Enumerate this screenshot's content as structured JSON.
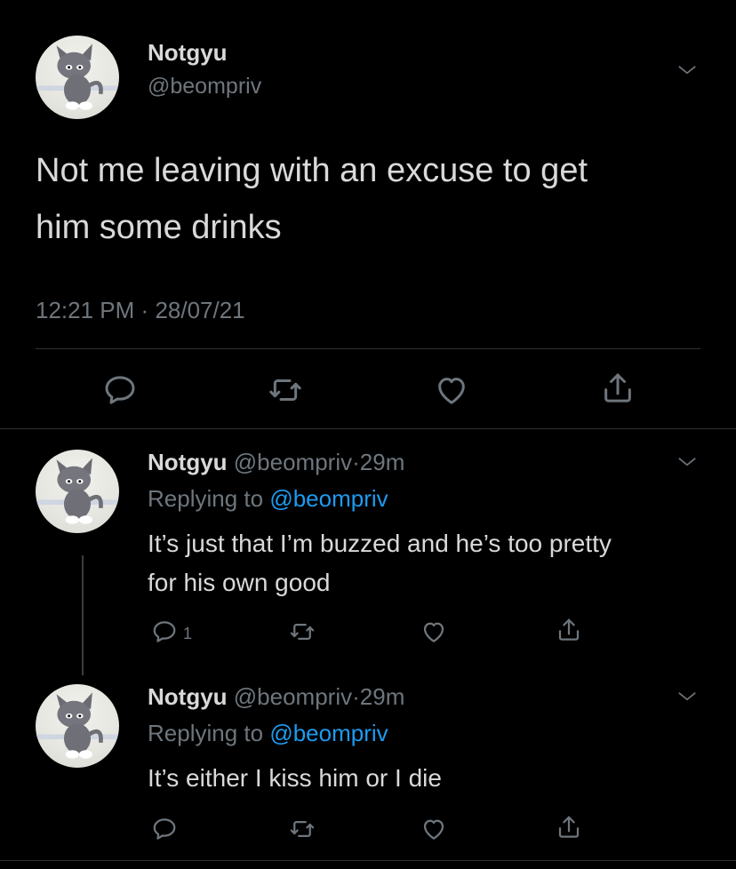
{
  "main_tweet": {
    "display_name": "Notgyu",
    "handle": "@beompriv",
    "text_line1": "Not me leaving with an excuse to get",
    "text_line2": "him some drinks",
    "time": "12:21 PM",
    "separator": "·",
    "date": "28/07/21"
  },
  "replies": [
    {
      "display_name": "Notgyu",
      "handle": "@beompriv",
      "separator": "·",
      "age": "29m",
      "replying_prefix": "Replying to",
      "replying_to": "@beompriv",
      "text_line1": "It’s just that I’m buzzed and he’s too pretty",
      "text_line2": "for his own good",
      "reply_count": "1"
    },
    {
      "display_name": "Notgyu",
      "handle": "@beompriv",
      "separator": "·",
      "age": "29m",
      "replying_prefix": "Replying to",
      "replying_to": "@beompriv",
      "text_line1": "It’s either I kiss him or I die"
    }
  ],
  "colors": {
    "background": "#000000",
    "text": "#d9d9d9",
    "muted": "#6e767d",
    "link": "#1d9bf0",
    "divider": "#2f3336"
  },
  "icons": [
    "chevron-down-icon",
    "reply-icon",
    "retweet-icon",
    "like-icon",
    "share-icon"
  ]
}
